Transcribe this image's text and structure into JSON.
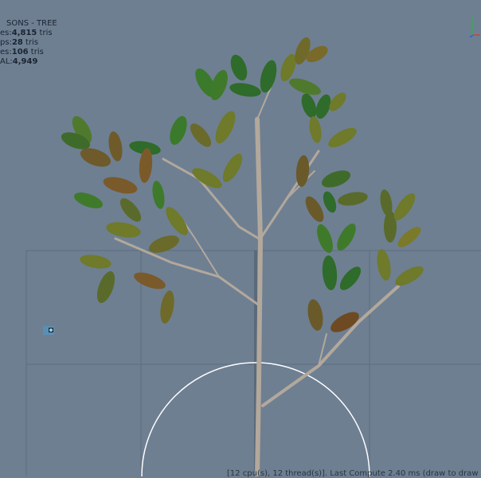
{
  "stats": {
    "title": "SONS - TREE",
    "rows": [
      {
        "label": "es:",
        "value": "4,815",
        "unit": " tris"
      },
      {
        "label": "ps:",
        "value": "28",
        "unit": " tris"
      },
      {
        "label": "es:",
        "value": "106",
        "unit": " tris"
      },
      {
        "label": "AL:",
        "value": "4,949",
        "unit": ""
      }
    ]
  },
  "status_bar": {
    "text": "[12 cpu(s), 12 thread(s)]. Last Compute 2.40 ms (draw to draw"
  },
  "colors": {
    "background": "#6e7f92",
    "grid": "#5f6f80",
    "bark": "#b3a89c",
    "leaf_dark": "#2f6b2a",
    "leaf_olive": "#6f7a2a",
    "leaf_brown": "#6e4a22"
  },
  "icons": {
    "gizmo": "axis-gizmo-icon",
    "camera": "camera-icon"
  }
}
